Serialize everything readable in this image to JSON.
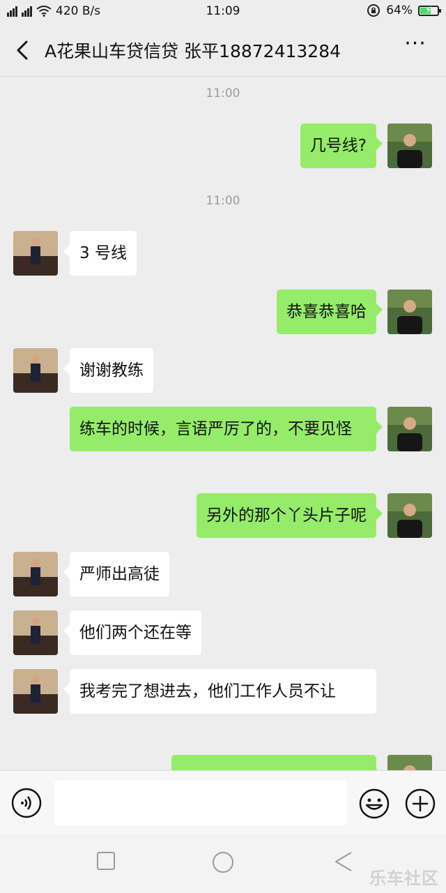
{
  "status_bar": {
    "net_speed": "420 B/s",
    "time": "11:09",
    "battery_percent": "64%",
    "battery_level": 0.64,
    "signal_labels": [
      "4G",
      "3G"
    ]
  },
  "header": {
    "title": "A花果山车贷信贷 张平18872413284",
    "more_label": "···"
  },
  "messages": {
    "ts1": "11:00",
    "m1": "几号线?",
    "ts2": "11:00",
    "m2": "3 号线",
    "m3": "恭喜恭喜哈",
    "m4": "谢谢教练",
    "m5": "练车的时候，言语严厉了的，不要见怪",
    "m6": "另外的那个丫头片子呢",
    "m7": "严师出高徒",
    "m8": "他们两个还在等",
    "m9": "我考完了想进去，他们工作人员不让"
  },
  "colors": {
    "outgoing_bubble": "#95ec69",
    "incoming_bubble": "#ffffff",
    "background": "#ededed"
  },
  "icons": {
    "voice": "voice-icon",
    "emoji": "emoji-icon",
    "plus": "plus-icon",
    "back": "back-arrow-icon",
    "more": "more-icon"
  },
  "watermark": "乐车社区"
}
